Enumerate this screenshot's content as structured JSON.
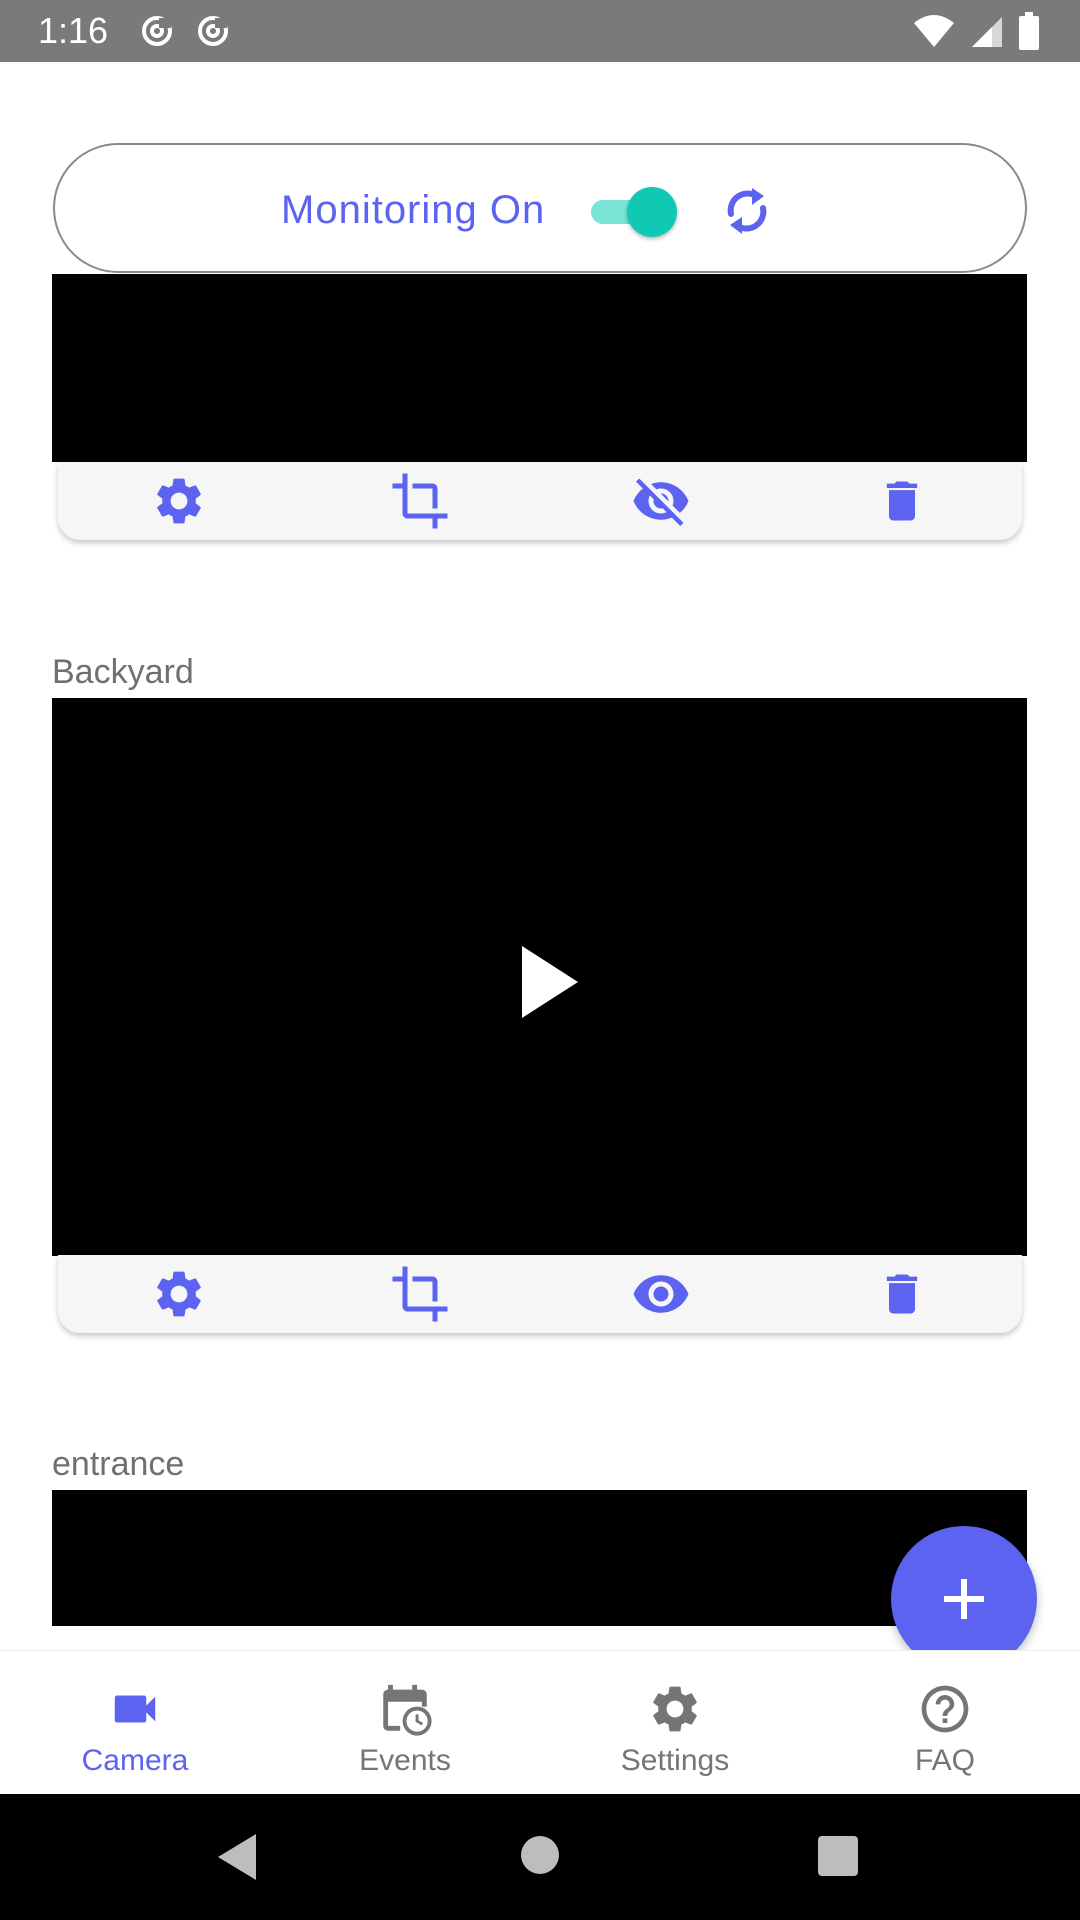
{
  "status_bar": {
    "time": "1:16"
  },
  "monitor": {
    "label": "Monitoring On",
    "enabled": true
  },
  "cameras": [
    {
      "name": "",
      "visibility_icon": "eye-off-icon"
    },
    {
      "name": "Backyard",
      "visibility_icon": "eye-icon"
    },
    {
      "name": "entrance"
    }
  ],
  "nav": {
    "items": [
      {
        "label": "Camera",
        "icon": "video-camera-icon",
        "active": true
      },
      {
        "label": "Events",
        "icon": "calendar-clock-icon",
        "active": false
      },
      {
        "label": "Settings",
        "icon": "gear-icon",
        "active": false
      },
      {
        "label": "FAQ",
        "icon": "help-circle-icon",
        "active": false
      }
    ]
  },
  "colors": {
    "accent": "#5b63f0",
    "toggle_on": "#10c9b5",
    "status_bar": "#7a7a7a"
  }
}
